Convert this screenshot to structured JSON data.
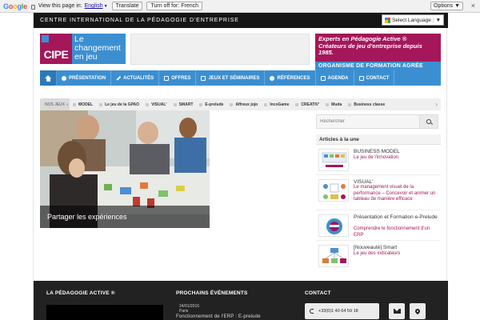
{
  "translate_bar": {
    "logo": "Google",
    "view_text": "View this page in:",
    "language": "English",
    "translate_label": "Translate",
    "turn_off_label": "Turn off for: French",
    "options_label": "Options ▼",
    "close": "×"
  },
  "topbar": {
    "title": "CENTRE INTERNATIONAL DE LA PÉDAGOGIE D'ENTREPRISE",
    "language_select": "Select Language",
    "language_arrow": "▼"
  },
  "logo": {
    "brand": "CIPE",
    "tagline_lines": [
      "Le",
      "changement",
      "en jeu"
    ],
    "brand_color": "#a4175a",
    "accent_color": "#3b8fd1"
  },
  "experts": {
    "lines": [
      "Experts en Pédagogie Active ®",
      "Créateurs de jeu d'entreprise depuis",
      "1985."
    ]
  },
  "organisme": "ORGANISME DE FORMATION AGRÉE",
  "nav": {
    "items": [
      {
        "label": "PRÉSENTATION",
        "icon": "user-icon"
      },
      {
        "label": "ACTUALITÉS",
        "icon": "pencil-icon"
      },
      {
        "label": "OFFRES",
        "icon": "briefcase-icon"
      },
      {
        "label": "JEUX ET SÉMINAIRES",
        "icon": "cards-icon"
      },
      {
        "label": "RÉFÉRENCES",
        "icon": "check-icon"
      },
      {
        "label": "AGENDA",
        "icon": "calendar-icon"
      },
      {
        "label": "CONTACT",
        "icon": "envelope-icon"
      }
    ]
  },
  "subnav": {
    "label": "NOS JEUX",
    "items": [
      "MODEL",
      "Le jeu de la GPAO",
      "VISUAL'",
      "SMART",
      "E-prelude",
      "Affreux jojo",
      "IncoGame",
      "CREATIV'",
      "Muda",
      "Business classe"
    ]
  },
  "hero": {
    "caption": "Partager les expériences"
  },
  "search": {
    "placeholder": "Rechercher"
  },
  "articles": {
    "heading": "Articles à la une",
    "items": [
      {
        "title": "BUSINESS MODEL",
        "subtitle": "Le jeu de l'innovation"
      },
      {
        "title": "VISUAL'",
        "subtitle": "Le management visuel de la performance – Concevoir et animer un tableau de manière efficace"
      },
      {
        "title": "Présentation et Formation e-Prelude",
        "subtitle": "Comprendre le fonctionnement d'un ERP"
      },
      {
        "title": "[Nouveauté] Smart",
        "subtitle": "Le jeu des indicateurs"
      }
    ]
  },
  "footer": {
    "col1_title": "LA PÉDAGOGIE ACTIVE ®",
    "col2_title": "PROCHAINS ÉVÉNEMENTS",
    "col3_title": "CONTACT",
    "event_date": "24/01/2016",
    "event_place": "Paris",
    "event_title": "Fonctionnement de l'ERP : E-prelude",
    "phone": "+33(0)1 40 64 59 18"
  }
}
